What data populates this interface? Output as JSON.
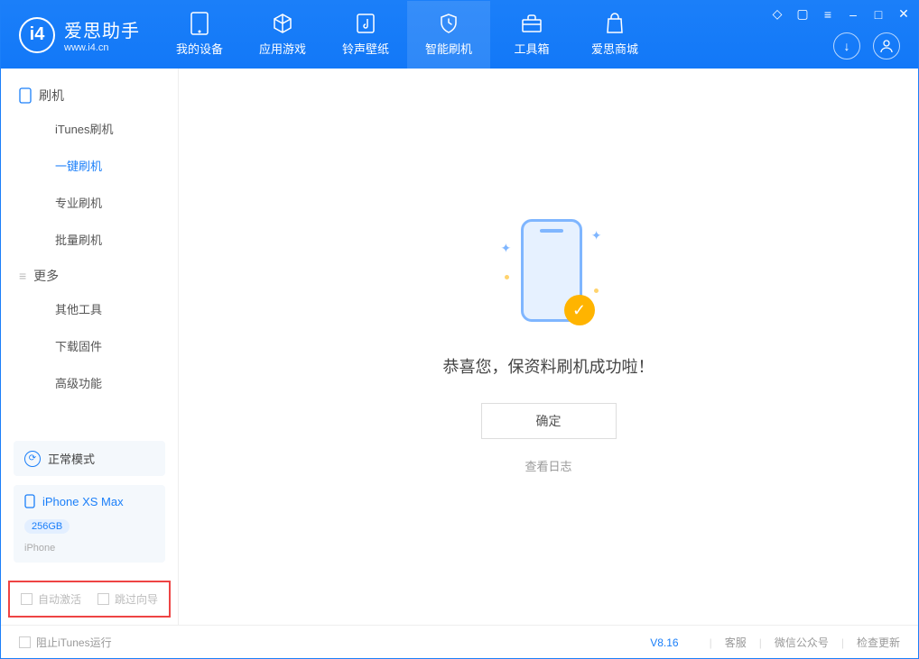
{
  "app": {
    "title": "爱思助手",
    "subtitle": "www.i4.cn"
  },
  "nav": [
    {
      "label": "我的设备"
    },
    {
      "label": "应用游戏"
    },
    {
      "label": "铃声壁纸"
    },
    {
      "label": "智能刷机"
    },
    {
      "label": "工具箱"
    },
    {
      "label": "爱思商城"
    }
  ],
  "sidebar": {
    "section1": {
      "title": "刷机",
      "items": [
        "iTunes刷机",
        "一键刷机",
        "专业刷机",
        "批量刷机"
      ]
    },
    "section2": {
      "title": "更多",
      "items": [
        "其他工具",
        "下载固件",
        "高级功能"
      ]
    }
  },
  "mode": {
    "label": "正常模式"
  },
  "device": {
    "name": "iPhone XS Max",
    "storage": "256GB",
    "type": "iPhone"
  },
  "options": {
    "auto_activate": "自动激活",
    "skip_guide": "跳过向导"
  },
  "main": {
    "message": "恭喜您，保资料刷机成功啦！",
    "ok": "确定",
    "log": "查看日志"
  },
  "footer": {
    "block_itunes": "阻止iTunes运行",
    "version": "V8.16",
    "support": "客服",
    "wechat": "微信公众号",
    "update": "检查更新"
  }
}
